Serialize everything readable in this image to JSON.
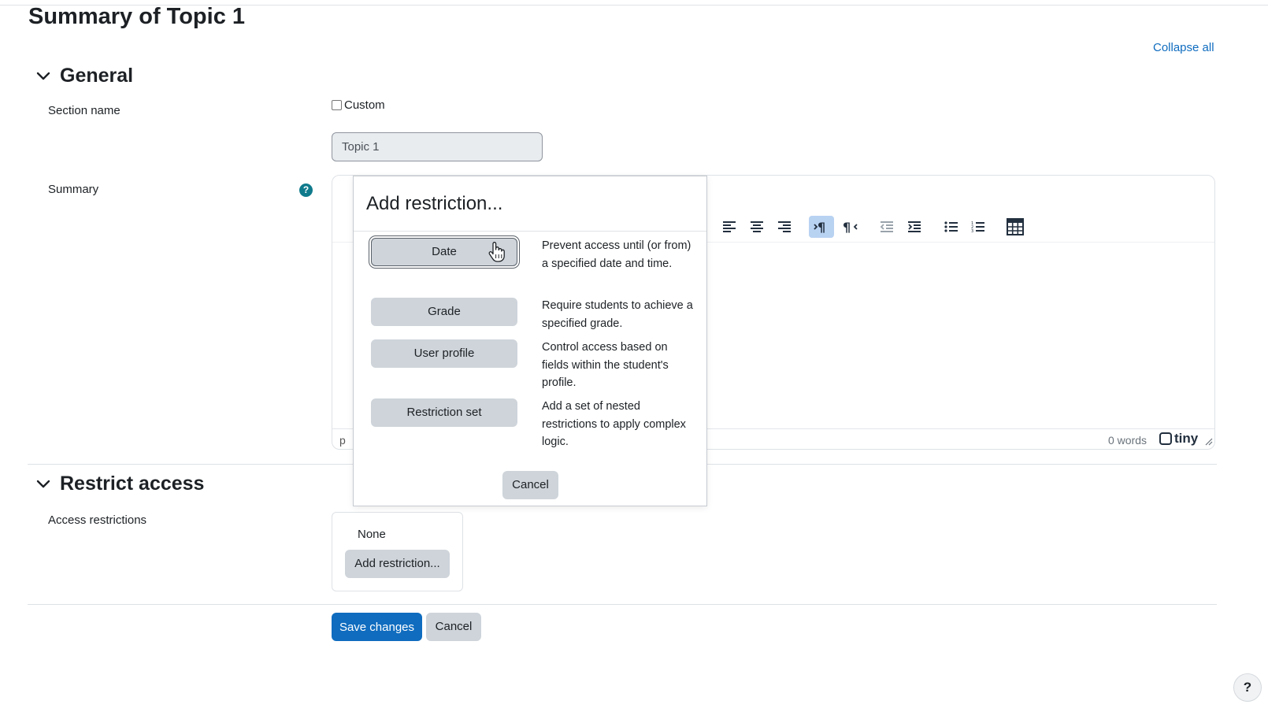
{
  "page": {
    "title": "Summary of Topic 1",
    "collapse_all": "Collapse all"
  },
  "general": {
    "heading": "General",
    "section_name_label": "Section name",
    "custom_label": "Custom",
    "section_name_value": "Topic 1",
    "summary_label": "Summary",
    "help_glyph": "?"
  },
  "editor": {
    "path": "p",
    "word_count": "0 words",
    "brand": "tiny"
  },
  "restrict": {
    "heading": "Restrict access",
    "access_label": "Access restrictions",
    "none_text": "None",
    "add_button": "Add restriction..."
  },
  "footer": {
    "save": "Save changes",
    "cancel": "Cancel"
  },
  "modal": {
    "title": "Add restriction...",
    "options": [
      {
        "label": "Date",
        "description": "Prevent access until (or from) a specified date and time."
      },
      {
        "label": "Grade",
        "description": "Require students to achieve a specified grade."
      },
      {
        "label": "User profile",
        "description": "Control access based on fields within the student's profile."
      },
      {
        "label": "Restriction set",
        "description": "Add a set of nested restrictions to apply complex logic."
      }
    ],
    "cancel": "Cancel"
  },
  "help_button": "?",
  "colors": {
    "primary": "#0f6cbf",
    "secondary_button": "#ced4da",
    "active_toolbar": "#b8d2f2",
    "help_icon": "#0f7a8c"
  },
  "icons": [
    "chevron-down-icon",
    "help-icon",
    "align-left-icon",
    "align-center-icon",
    "align-right-icon",
    "ltr-icon",
    "rtl-icon",
    "outdent-icon",
    "indent-icon",
    "bullet-list-icon",
    "numbered-list-icon",
    "table-icon",
    "resize-handle-icon",
    "cursor-hand-icon"
  ]
}
